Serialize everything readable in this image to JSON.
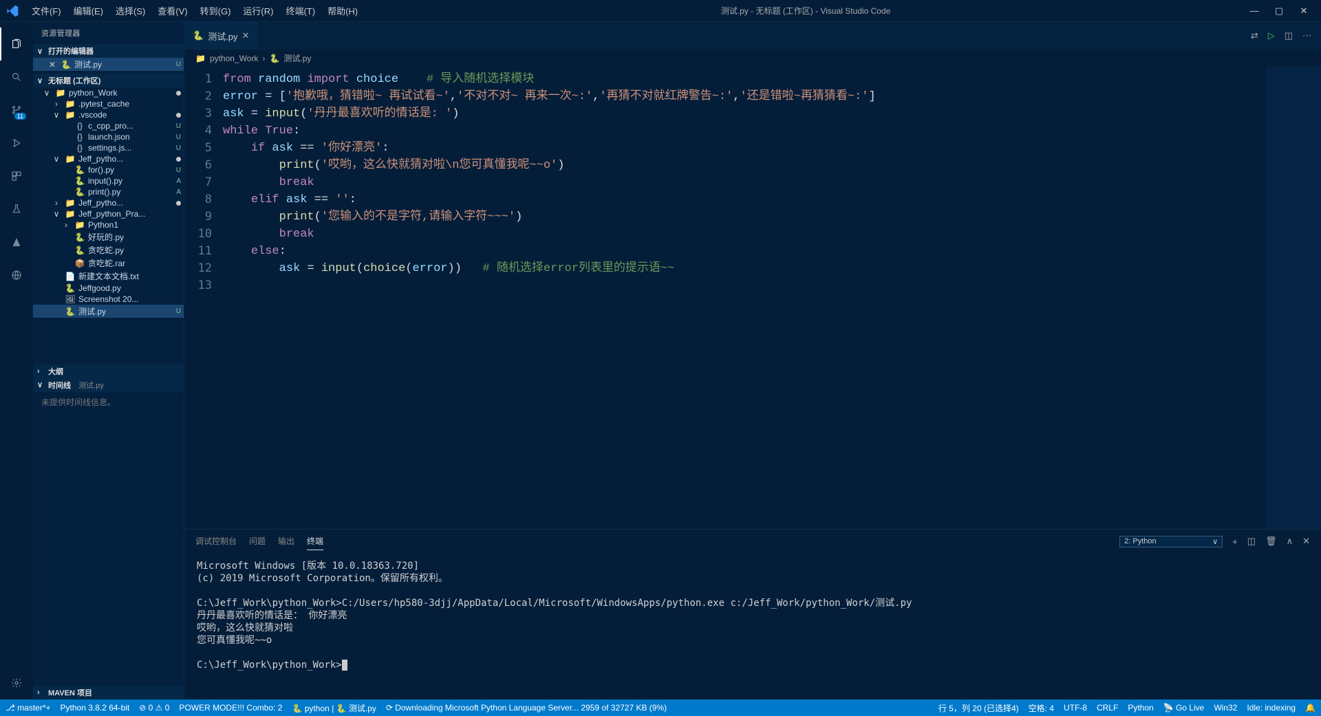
{
  "window": {
    "title": "测试.py - 无标题 (工作区) - Visual Studio Code"
  },
  "menubar": [
    "文件(F)",
    "编辑(E)",
    "选择(S)",
    "查看(V)",
    "转到(G)",
    "运行(R)",
    "终端(T)",
    "帮助(H)"
  ],
  "windowControls": [
    "—",
    "▢",
    "✕"
  ],
  "activityBadge": "11",
  "sidebar": {
    "title": "资源管理器",
    "openEditors": "打开的编辑器",
    "openItem": {
      "name": "测试.py",
      "status": "U"
    },
    "workspace": "无标题 (工作区)",
    "tree": [
      {
        "depth": 0,
        "icon": "📁",
        "name": "python_Work",
        "chev": "∨",
        "dot": true
      },
      {
        "depth": 1,
        "icon": "📁",
        "name": ".pytest_cache",
        "chev": "›"
      },
      {
        "depth": 1,
        "icon": "📁",
        "name": ".vscode",
        "chev": "∨",
        "dot": true
      },
      {
        "depth": 2,
        "icon": "{}",
        "name": "c_cpp_pro...",
        "status": "U"
      },
      {
        "depth": 2,
        "icon": "{}",
        "name": "launch.json",
        "status": "U"
      },
      {
        "depth": 2,
        "icon": "{}",
        "name": "settings.js...",
        "status": "U"
      },
      {
        "depth": 1,
        "icon": "📁",
        "name": "Jeff_pytho...",
        "chev": "∨",
        "dot": true
      },
      {
        "depth": 2,
        "icon": "🐍",
        "name": "for().py",
        "status": "U"
      },
      {
        "depth": 2,
        "icon": "🐍",
        "name": "input().py",
        "status": "A"
      },
      {
        "depth": 2,
        "icon": "🐍",
        "name": "print().py",
        "status": "A"
      },
      {
        "depth": 1,
        "icon": "📁",
        "name": "Jeff_pytho...",
        "chev": "›",
        "dot": true
      },
      {
        "depth": 1,
        "icon": "📁",
        "name": "Jeff_python_Pra...",
        "chev": "∨"
      },
      {
        "depth": 2,
        "icon": "📁",
        "name": "Python1",
        "chev": "›"
      },
      {
        "depth": 2,
        "icon": "🐍",
        "name": "好玩的.py"
      },
      {
        "depth": 2,
        "icon": "🐍",
        "name": "贪吃蛇.py"
      },
      {
        "depth": 2,
        "icon": "📦",
        "name": "贪吃蛇.rar"
      },
      {
        "depth": 1,
        "icon": "📄",
        "name": "新建文本文档.txt"
      },
      {
        "depth": 1,
        "icon": "🐍",
        "name": "Jeffgood.py"
      },
      {
        "depth": 1,
        "icon": "🖼",
        "name": "Screenshot 20..."
      },
      {
        "depth": 1,
        "icon": "🐍",
        "name": "测试.py",
        "status": "U",
        "selected": true
      }
    ],
    "outline": "大纲",
    "timeline": "时间线",
    "timelineFile": "测试.py",
    "timelineEmpty": "未提供时间线信息。",
    "maven": "MAVEN 项目"
  },
  "tabs": [
    {
      "name": "测试.py",
      "active": true
    }
  ],
  "breadcrumb": [
    "python_Work",
    "测试.py"
  ],
  "code": {
    "lines": [
      {
        "n": 1,
        "html": "<span class='kw'>from</span> <span class='id'>random</span> <span class='kw'>import</span> <span class='id'>choice</span>    <span class='cmt'># 导入随机选择模块</span>"
      },
      {
        "n": 2,
        "html": "<span class='id'>error</span> <span class='op'>=</span> [<span class='str'>'抱歉哦，猜错啦~ 再试试看~'</span>,<span class='str'>'不对不对~ 再来一次~:'</span>,<span class='str'>'再猜不对就红牌警告~:'</span>,<span class='str'>'还是错啦~再猜猜看~:'</span>]"
      },
      {
        "n": 3,
        "html": "<span class='id'>ask</span> <span class='op'>=</span> <span class='fn'>input</span>(<span class='str'>'丹丹最喜欢听的情话是: '</span>)"
      },
      {
        "n": 4,
        "html": "<span class='kw'>while</span> <span class='kw'>True</span>:"
      },
      {
        "n": 5,
        "html": "    <span class='kw'>if</span> <span class='id'>ask</span> <span class='op'>==</span> <span class='str'>'你好漂亮'</span>:"
      },
      {
        "n": 6,
        "html": "        <span class='fn'>print</span>(<span class='str'>'哎哟，这么快就猜对啦\\n您可真懂我呢~~o'</span>)"
      },
      {
        "n": 7,
        "html": "        <span class='kw'>break</span>"
      },
      {
        "n": 8,
        "html": "    <span class='kw'>elif</span> <span class='id'>ask</span> <span class='op'>==</span> <span class='str'>''</span>:"
      },
      {
        "n": 9,
        "html": "        <span class='fn'>print</span>(<span class='str'>'您输入的不是字符,请输入字符~~~'</span>)"
      },
      {
        "n": 10,
        "html": "        <span class='kw'>break</span>"
      },
      {
        "n": 11,
        "html": "    <span class='kw'>else</span>:"
      },
      {
        "n": 12,
        "html": "        <span class='id'>ask</span> <span class='op'>=</span> <span class='fn'>input</span>(<span class='fn'>choice</span><span class='op'>(</span><span class='id'>error</span><span class='op'>)</span>)   <span class='cmt'># 随机选择error列表里的提示语~~</span>"
      },
      {
        "n": 13,
        "html": ""
      }
    ]
  },
  "panel": {
    "tabs": [
      "调试控制台",
      "问题",
      "输出",
      "终端"
    ],
    "activeTab": 3,
    "terminalSelect": "2: Python",
    "terminalText": "Microsoft Windows [版本 10.0.18363.720]\n(c) 2019 Microsoft Corporation。保留所有权利。\n\nC:\\Jeff_Work\\python_Work>C:/Users/hp580-3djj/AppData/Local/Microsoft/WindowsApps/python.exe c:/Jeff_Work/python_Work/测试.py\n丹丹最喜欢听的情话是： 你好漂亮\n哎哟，这么快就猜对啦\n您可真懂我呢~~o\n\nC:\\Jeff_Work\\python_Work>"
  },
  "status": {
    "left": [
      "⎇ master*+",
      "Python 3.8.2 64-bit",
      "⊘ 0 ⚠ 0",
      "POWER MODE!!! Combo: 2",
      "🐍 python | 🐍 测试.py",
      "⟳ Downloading Microsoft Python Language Server... 2959 of 32727 KB (9%)"
    ],
    "right": [
      "行 5，列 20 (已选择4)",
      "空格: 4",
      "UTF-8",
      "CRLF",
      "Python",
      "📡 Go Live",
      "Win32",
      "Idle: indexing",
      "🔔"
    ]
  }
}
